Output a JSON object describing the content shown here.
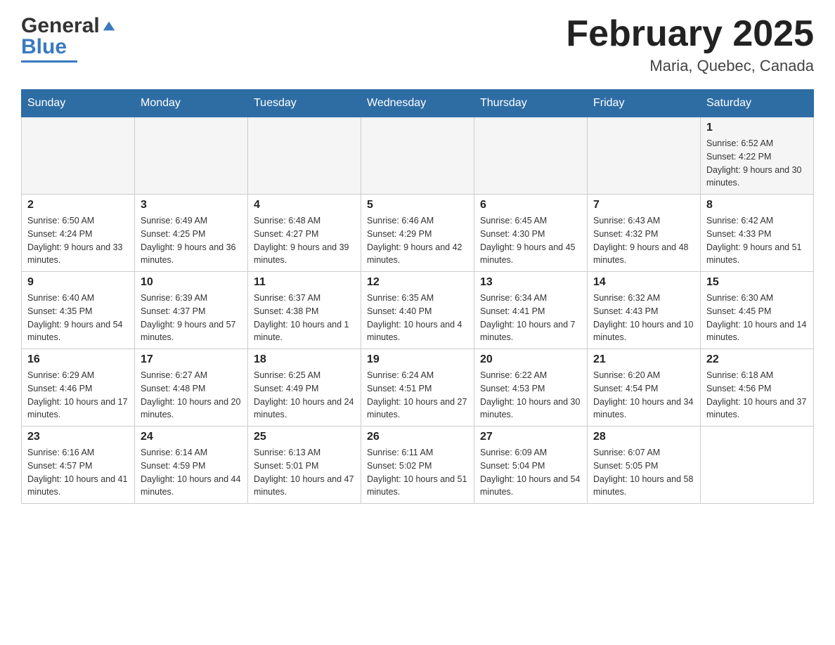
{
  "header": {
    "logo": {
      "part1": "General",
      "part2": "Blue"
    },
    "title": "February 2025",
    "location": "Maria, Quebec, Canada"
  },
  "weekdays": [
    "Sunday",
    "Monday",
    "Tuesday",
    "Wednesday",
    "Thursday",
    "Friday",
    "Saturday"
  ],
  "weeks": [
    [
      {
        "day": "",
        "info": ""
      },
      {
        "day": "",
        "info": ""
      },
      {
        "day": "",
        "info": ""
      },
      {
        "day": "",
        "info": ""
      },
      {
        "day": "",
        "info": ""
      },
      {
        "day": "",
        "info": ""
      },
      {
        "day": "1",
        "info": "Sunrise: 6:52 AM\nSunset: 4:22 PM\nDaylight: 9 hours and 30 minutes."
      }
    ],
    [
      {
        "day": "2",
        "info": "Sunrise: 6:50 AM\nSunset: 4:24 PM\nDaylight: 9 hours and 33 minutes."
      },
      {
        "day": "3",
        "info": "Sunrise: 6:49 AM\nSunset: 4:25 PM\nDaylight: 9 hours and 36 minutes."
      },
      {
        "day": "4",
        "info": "Sunrise: 6:48 AM\nSunset: 4:27 PM\nDaylight: 9 hours and 39 minutes."
      },
      {
        "day": "5",
        "info": "Sunrise: 6:46 AM\nSunset: 4:29 PM\nDaylight: 9 hours and 42 minutes."
      },
      {
        "day": "6",
        "info": "Sunrise: 6:45 AM\nSunset: 4:30 PM\nDaylight: 9 hours and 45 minutes."
      },
      {
        "day": "7",
        "info": "Sunrise: 6:43 AM\nSunset: 4:32 PM\nDaylight: 9 hours and 48 minutes."
      },
      {
        "day": "8",
        "info": "Sunrise: 6:42 AM\nSunset: 4:33 PM\nDaylight: 9 hours and 51 minutes."
      }
    ],
    [
      {
        "day": "9",
        "info": "Sunrise: 6:40 AM\nSunset: 4:35 PM\nDaylight: 9 hours and 54 minutes."
      },
      {
        "day": "10",
        "info": "Sunrise: 6:39 AM\nSunset: 4:37 PM\nDaylight: 9 hours and 57 minutes."
      },
      {
        "day": "11",
        "info": "Sunrise: 6:37 AM\nSunset: 4:38 PM\nDaylight: 10 hours and 1 minute."
      },
      {
        "day": "12",
        "info": "Sunrise: 6:35 AM\nSunset: 4:40 PM\nDaylight: 10 hours and 4 minutes."
      },
      {
        "day": "13",
        "info": "Sunrise: 6:34 AM\nSunset: 4:41 PM\nDaylight: 10 hours and 7 minutes."
      },
      {
        "day": "14",
        "info": "Sunrise: 6:32 AM\nSunset: 4:43 PM\nDaylight: 10 hours and 10 minutes."
      },
      {
        "day": "15",
        "info": "Sunrise: 6:30 AM\nSunset: 4:45 PM\nDaylight: 10 hours and 14 minutes."
      }
    ],
    [
      {
        "day": "16",
        "info": "Sunrise: 6:29 AM\nSunset: 4:46 PM\nDaylight: 10 hours and 17 minutes."
      },
      {
        "day": "17",
        "info": "Sunrise: 6:27 AM\nSunset: 4:48 PM\nDaylight: 10 hours and 20 minutes."
      },
      {
        "day": "18",
        "info": "Sunrise: 6:25 AM\nSunset: 4:49 PM\nDaylight: 10 hours and 24 minutes."
      },
      {
        "day": "19",
        "info": "Sunrise: 6:24 AM\nSunset: 4:51 PM\nDaylight: 10 hours and 27 minutes."
      },
      {
        "day": "20",
        "info": "Sunrise: 6:22 AM\nSunset: 4:53 PM\nDaylight: 10 hours and 30 minutes."
      },
      {
        "day": "21",
        "info": "Sunrise: 6:20 AM\nSunset: 4:54 PM\nDaylight: 10 hours and 34 minutes."
      },
      {
        "day": "22",
        "info": "Sunrise: 6:18 AM\nSunset: 4:56 PM\nDaylight: 10 hours and 37 minutes."
      }
    ],
    [
      {
        "day": "23",
        "info": "Sunrise: 6:16 AM\nSunset: 4:57 PM\nDaylight: 10 hours and 41 minutes."
      },
      {
        "day": "24",
        "info": "Sunrise: 6:14 AM\nSunset: 4:59 PM\nDaylight: 10 hours and 44 minutes."
      },
      {
        "day": "25",
        "info": "Sunrise: 6:13 AM\nSunset: 5:01 PM\nDaylight: 10 hours and 47 minutes."
      },
      {
        "day": "26",
        "info": "Sunrise: 6:11 AM\nSunset: 5:02 PM\nDaylight: 10 hours and 51 minutes."
      },
      {
        "day": "27",
        "info": "Sunrise: 6:09 AM\nSunset: 5:04 PM\nDaylight: 10 hours and 54 minutes."
      },
      {
        "day": "28",
        "info": "Sunrise: 6:07 AM\nSunset: 5:05 PM\nDaylight: 10 hours and 58 minutes."
      },
      {
        "day": "",
        "info": ""
      }
    ]
  ]
}
